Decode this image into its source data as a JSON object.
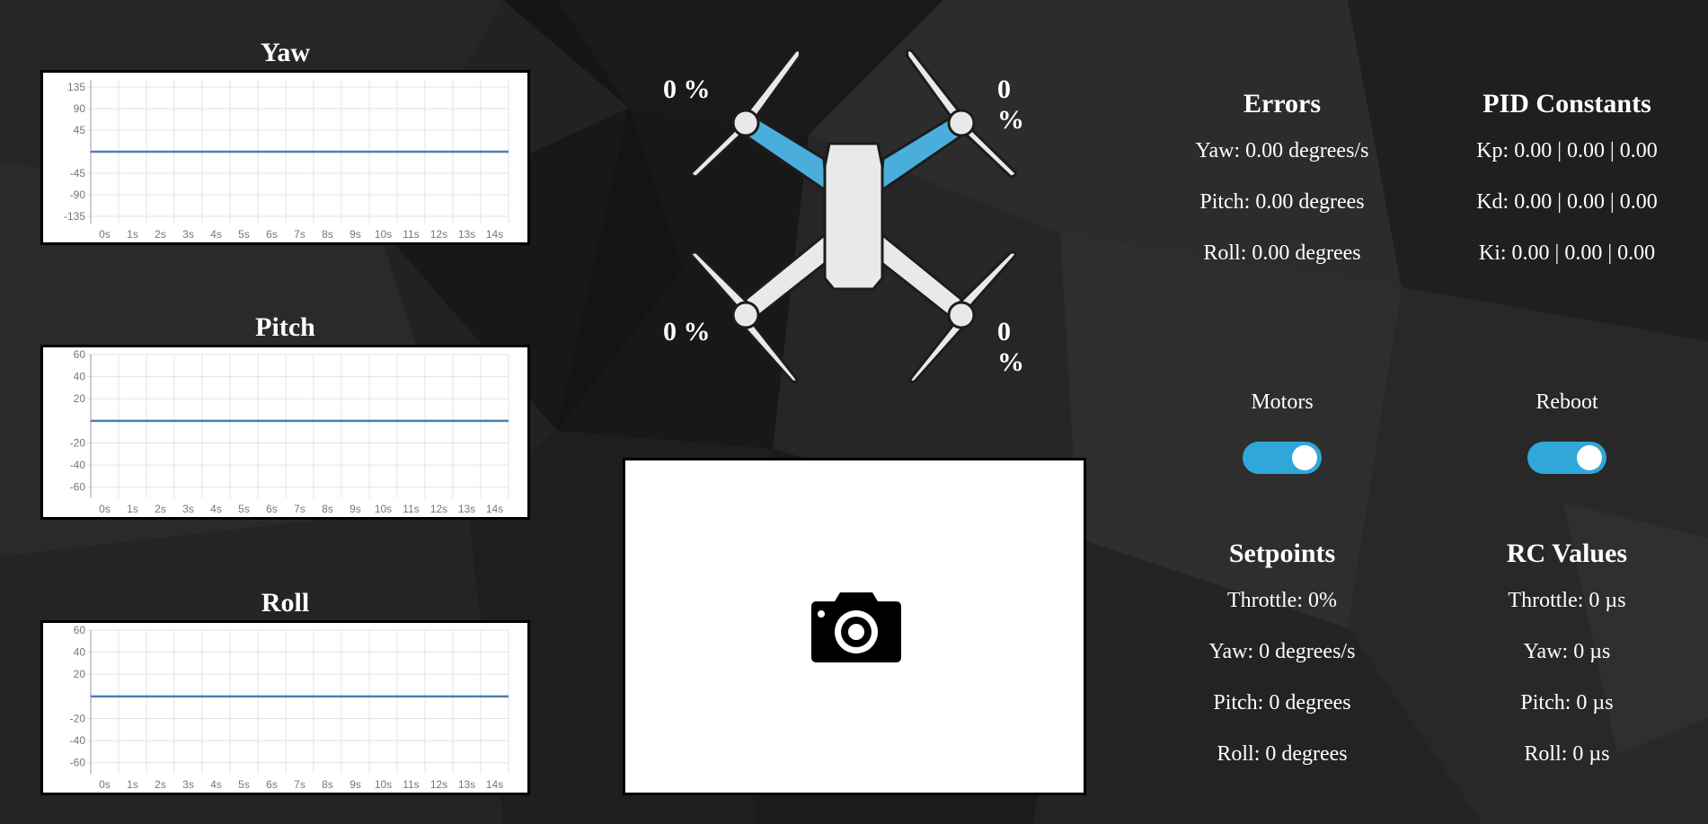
{
  "charts": [
    {
      "title": "Yaw",
      "yticks": [
        "135",
        "90",
        "45",
        "-45",
        "-90",
        "-135"
      ],
      "ytick_values": [
        135,
        90,
        45,
        -45,
        -90,
        -135
      ],
      "ylim": [
        -150,
        150
      ],
      "xticks": [
        "0s",
        "1s",
        "2s",
        "3s",
        "4s",
        "5s",
        "6s",
        "7s",
        "8s",
        "9s",
        "10s",
        "11s",
        "12s",
        "13s",
        "14s"
      ],
      "series_value": 0
    },
    {
      "title": "Pitch",
      "yticks": [
        "60",
        "40",
        "20",
        "-20",
        "-40",
        "-60"
      ],
      "ytick_values": [
        60,
        40,
        20,
        -20,
        -40,
        -60
      ],
      "ylim": [
        -70,
        60
      ],
      "xticks": [
        "0s",
        "1s",
        "2s",
        "3s",
        "4s",
        "5s",
        "6s",
        "7s",
        "8s",
        "9s",
        "10s",
        "11s",
        "12s",
        "13s",
        "14s"
      ],
      "series_value": 0
    },
    {
      "title": "Roll",
      "yticks": [
        "60",
        "40",
        "20",
        "-20",
        "-40",
        "-60"
      ],
      "ytick_values": [
        60,
        40,
        20,
        -20,
        -40,
        -60
      ],
      "ylim": [
        -70,
        60
      ],
      "xticks": [
        "0s",
        "1s",
        "2s",
        "3s",
        "4s",
        "5s",
        "6s",
        "7s",
        "8s",
        "9s",
        "10s",
        "11s",
        "12s",
        "13s",
        "14s"
      ],
      "series_value": 0
    }
  ],
  "drone": {
    "motor_front_left": "0 %",
    "motor_front_right": "0 %",
    "motor_back_left": "0 %",
    "motor_back_right": "0 %",
    "arm_front_color": "#4aaedc",
    "body_color": "#e9e9ea"
  },
  "errors": {
    "title": "Errors",
    "yaw": "Yaw: 0.00 degrees/s",
    "pitch": "Pitch: 0.00 degrees",
    "roll": "Roll: 0.00 degrees"
  },
  "pid": {
    "title": "PID Constants",
    "kp": "Kp: 0.00 | 0.00 | 0.00",
    "kd": "Kd: 0.00 | 0.00 | 0.00",
    "ki": "Ki: 0.00 | 0.00 | 0.00"
  },
  "toggles": {
    "motors_label": "Motors",
    "motors_on": true,
    "reboot_label": "Reboot",
    "reboot_on": true,
    "color": "#2fa7d8"
  },
  "setpoints": {
    "title": "Setpoints",
    "throttle": "Throttle: 0%",
    "yaw": "Yaw: 0 degrees/s",
    "pitch": "Pitch: 0 degrees",
    "roll": "Roll: 0 degrees"
  },
  "rc_values": {
    "title": "RC Values",
    "throttle": "Throttle: 0 µs",
    "yaw": "Yaw: 0 µs",
    "pitch": "Pitch: 0 µs",
    "roll": "Roll: 0 µs"
  },
  "camera": {
    "icon": "camera-icon"
  },
  "colors": {
    "series_line": "#4a7fb5",
    "grid": "#e3e3e3"
  }
}
